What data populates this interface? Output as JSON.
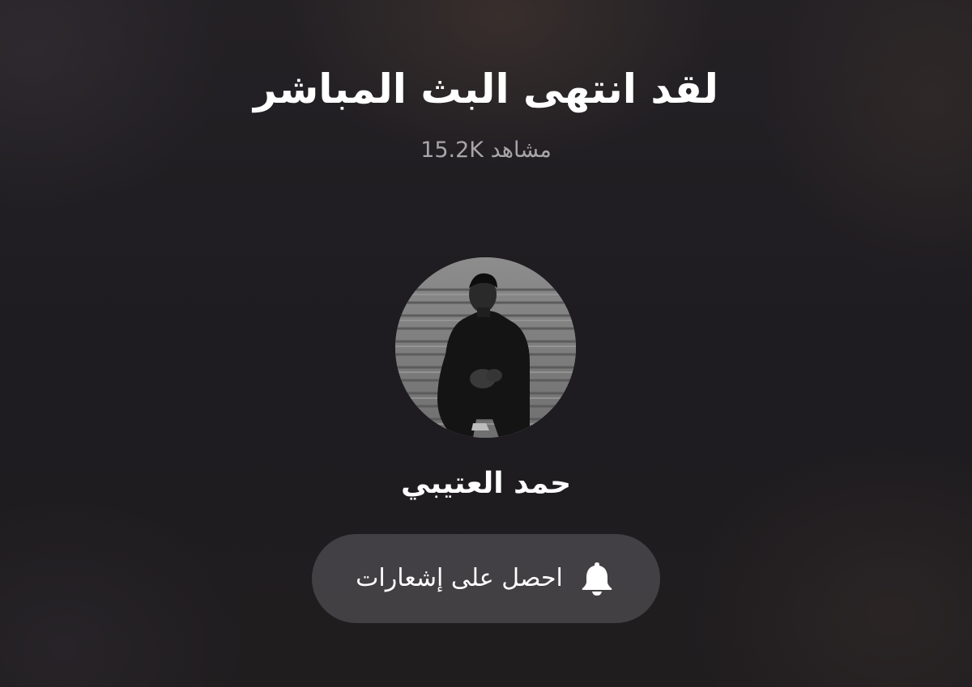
{
  "live_status": {
    "title": "لقد انتهى البث المباشر",
    "viewer_count": "15.2K",
    "viewer_label": "مشاهد"
  },
  "host": {
    "name": "حمد العتيبي",
    "avatar_icon": "profile-photo"
  },
  "notify_button": {
    "label": "احصل على إشعارات",
    "icon": "bell-icon"
  },
  "colors": {
    "background": "#1e1c20",
    "text_primary": "#ffffff",
    "text_secondary": "#a9a6aa",
    "button_bg": "#58555a"
  }
}
